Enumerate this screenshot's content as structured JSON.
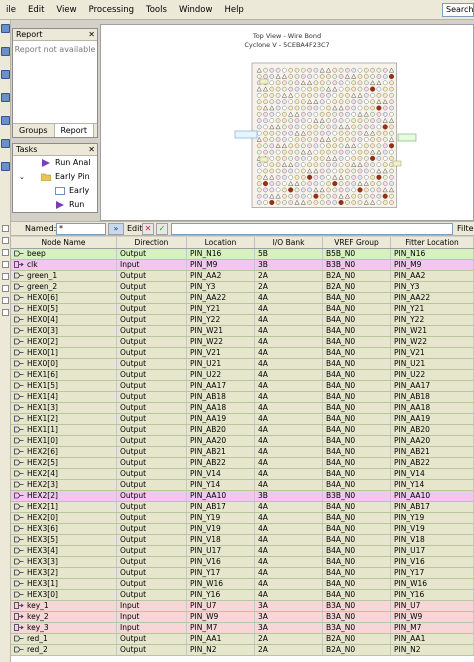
{
  "menu": {
    "items": [
      "ile",
      "Edit",
      "View",
      "Processing",
      "Tools",
      "Window",
      "Help"
    ],
    "search_text": "Search"
  },
  "report_panel": {
    "title": "Report",
    "message": "Report not available",
    "tabs": [
      "Groups",
      "Report"
    ]
  },
  "tasks_panel": {
    "title": "Tasks",
    "items": [
      {
        "label": "Run Anal",
        "icon": "play-icon"
      },
      {
        "label": "Early Pin",
        "icon": "folder-icon"
      },
      {
        "label": "Early",
        "icon": "document-icon"
      },
      {
        "label": "Run",
        "icon": "play-icon"
      }
    ]
  },
  "diagram": {
    "title_line1": "Top View - Wire Bond",
    "title_line2": "Cyclone V - 5CEBA4F23C7"
  },
  "filter_bar": {
    "named_label": "Named:",
    "named_value": "*",
    "edit_label": "Edit:",
    "filter_label": "Filter"
  },
  "table": {
    "columns": [
      "Node Name",
      "Direction",
      "Location",
      "I/O Bank",
      "VREF Group",
      "Fitter Location"
    ],
    "rows": [
      {
        "name": "beep",
        "dir": "Output",
        "loc": "PIN_N16",
        "bank": "5B",
        "vref": "B5B_N0",
        "fitter": "PIN_N16",
        "kind": "output",
        "bg": "#d6f0c0"
      },
      {
        "name": "clk",
        "dir": "Input",
        "loc": "PIN_M9",
        "bank": "3B",
        "vref": "B3B_N0",
        "fitter": "PIN_M9",
        "kind": "input",
        "bg": "#f2c6ee"
      },
      {
        "name": "green_1",
        "dir": "Output",
        "loc": "PIN_AA2",
        "bank": "2A",
        "vref": "B2A_N0",
        "fitter": "PIN_AA2",
        "kind": "output",
        "bg": "#e6e6cc"
      },
      {
        "name": "green_2",
        "dir": "Output",
        "loc": "PIN_Y3",
        "bank": "2A",
        "vref": "B2A_N0",
        "fitter": "PIN_Y3",
        "kind": "output",
        "bg": "#e6e6cc"
      },
      {
        "name": "HEX0[6]",
        "dir": "Output",
        "loc": "PIN_AA22",
        "bank": "4A",
        "vref": "B4A_N0",
        "fitter": "PIN_AA22",
        "kind": "output",
        "bg": "#e6e6cc"
      },
      {
        "name": "HEX0[5]",
        "dir": "Output",
        "loc": "PIN_Y21",
        "bank": "4A",
        "vref": "B4A_N0",
        "fitter": "PIN_Y21",
        "kind": "output",
        "bg": "#e6e6cc"
      },
      {
        "name": "HEX0[4]",
        "dir": "Output",
        "loc": "PIN_Y22",
        "bank": "4A",
        "vref": "B4A_N0",
        "fitter": "PIN_Y22",
        "kind": "output",
        "bg": "#e6e6cc"
      },
      {
        "name": "HEX0[3]",
        "dir": "Output",
        "loc": "PIN_W21",
        "bank": "4A",
        "vref": "B4A_N0",
        "fitter": "PIN_W21",
        "kind": "output",
        "bg": "#e6e6cc"
      },
      {
        "name": "HEX0[2]",
        "dir": "Output",
        "loc": "PIN_W22",
        "bank": "4A",
        "vref": "B4A_N0",
        "fitter": "PIN_W22",
        "kind": "output",
        "bg": "#e6e6cc"
      },
      {
        "name": "HEX0[1]",
        "dir": "Output",
        "loc": "PIN_V21",
        "bank": "4A",
        "vref": "B4A_N0",
        "fitter": "PIN_V21",
        "kind": "output",
        "bg": "#e6e6cc"
      },
      {
        "name": "HEX0[0]",
        "dir": "Output",
        "loc": "PIN_U21",
        "bank": "4A",
        "vref": "B4A_N0",
        "fitter": "PIN_U21",
        "kind": "output",
        "bg": "#e6e6cc"
      },
      {
        "name": "HEX1[6]",
        "dir": "Output",
        "loc": "PIN_U22",
        "bank": "4A",
        "vref": "B4A_N0",
        "fitter": "PIN_U22",
        "kind": "output",
        "bg": "#e6e6cc"
      },
      {
        "name": "HEX1[5]",
        "dir": "Output",
        "loc": "PIN_AA17",
        "bank": "4A",
        "vref": "B4A_N0",
        "fitter": "PIN_AA17",
        "kind": "output",
        "bg": "#e6e6cc"
      },
      {
        "name": "HEX1[4]",
        "dir": "Output",
        "loc": "PIN_AB18",
        "bank": "4A",
        "vref": "B4A_N0",
        "fitter": "PIN_AB18",
        "kind": "output",
        "bg": "#e6e6cc"
      },
      {
        "name": "HEX1[3]",
        "dir": "Output",
        "loc": "PIN_AA18",
        "bank": "4A",
        "vref": "B4A_N0",
        "fitter": "PIN_AA18",
        "kind": "output",
        "bg": "#e6e6cc"
      },
      {
        "name": "HEX1[2]",
        "dir": "Output",
        "loc": "PIN_AA19",
        "bank": "4A",
        "vref": "B4A_N0",
        "fitter": "PIN_AA19",
        "kind": "output",
        "bg": "#e6e6cc"
      },
      {
        "name": "HEX1[1]",
        "dir": "Output",
        "loc": "PIN_AB20",
        "bank": "4A",
        "vref": "B4A_N0",
        "fitter": "PIN_AB20",
        "kind": "output",
        "bg": "#e6e6cc"
      },
      {
        "name": "HEX1[0]",
        "dir": "Output",
        "loc": "PIN_AA20",
        "bank": "4A",
        "vref": "B4A_N0",
        "fitter": "PIN_AA20",
        "kind": "output",
        "bg": "#e6e6cc"
      },
      {
        "name": "HEX2[6]",
        "dir": "Output",
        "loc": "PIN_AB21",
        "bank": "4A",
        "vref": "B4A_N0",
        "fitter": "PIN_AB21",
        "kind": "output",
        "bg": "#e6e6cc"
      },
      {
        "name": "HEX2[5]",
        "dir": "Output",
        "loc": "PIN_AB22",
        "bank": "4A",
        "vref": "B4A_N0",
        "fitter": "PIN_AB22",
        "kind": "output",
        "bg": "#e6e6cc"
      },
      {
        "name": "HEX2[4]",
        "dir": "Output",
        "loc": "PIN_V14",
        "bank": "4A",
        "vref": "B4A_N0",
        "fitter": "PIN_V14",
        "kind": "output",
        "bg": "#e6e6cc"
      },
      {
        "name": "HEX2[3]",
        "dir": "Output",
        "loc": "PIN_Y14",
        "bank": "4A",
        "vref": "B4A_N0",
        "fitter": "PIN_Y14",
        "kind": "output",
        "bg": "#e6e6cc"
      },
      {
        "name": "HEX2[2]",
        "dir": "Output",
        "loc": "PIN_AA10",
        "bank": "3B",
        "vref": "B3B_N0",
        "fitter": "PIN_AA10",
        "kind": "output",
        "bg": "#f2c6ee"
      },
      {
        "name": "HEX2[1]",
        "dir": "Output",
        "loc": "PIN_AB17",
        "bank": "4A",
        "vref": "B4A_N0",
        "fitter": "PIN_AB17",
        "kind": "output",
        "bg": "#e6e6cc"
      },
      {
        "name": "HEX2[0]",
        "dir": "Output",
        "loc": "PIN_Y19",
        "bank": "4A",
        "vref": "B4A_N0",
        "fitter": "PIN_Y19",
        "kind": "output",
        "bg": "#e6e6cc"
      },
      {
        "name": "HEX3[6]",
        "dir": "Output",
        "loc": "PIN_V19",
        "bank": "4A",
        "vref": "B4A_N0",
        "fitter": "PIN_V19",
        "kind": "output",
        "bg": "#e6e6cc"
      },
      {
        "name": "HEX3[5]",
        "dir": "Output",
        "loc": "PIN_V18",
        "bank": "4A",
        "vref": "B4A_N0",
        "fitter": "PIN_V18",
        "kind": "output",
        "bg": "#e6e6cc"
      },
      {
        "name": "HEX3[4]",
        "dir": "Output",
        "loc": "PIN_U17",
        "bank": "4A",
        "vref": "B4A_N0",
        "fitter": "PIN_U17",
        "kind": "output",
        "bg": "#e6e6cc"
      },
      {
        "name": "HEX3[3]",
        "dir": "Output",
        "loc": "PIN_V16",
        "bank": "4A",
        "vref": "B4A_N0",
        "fitter": "PIN_V16",
        "kind": "output",
        "bg": "#e6e6cc"
      },
      {
        "name": "HEX3[2]",
        "dir": "Output",
        "loc": "PIN_Y17",
        "bank": "4A",
        "vref": "B4A_N0",
        "fitter": "PIN_Y17",
        "kind": "output",
        "bg": "#e6e6cc"
      },
      {
        "name": "HEX3[1]",
        "dir": "Output",
        "loc": "PIN_W16",
        "bank": "4A",
        "vref": "B4A_N0",
        "fitter": "PIN_W16",
        "kind": "output",
        "bg": "#e6e6cc"
      },
      {
        "name": "HEX3[0]",
        "dir": "Output",
        "loc": "PIN_Y16",
        "bank": "4A",
        "vref": "B4A_N0",
        "fitter": "PIN_Y16",
        "kind": "output",
        "bg": "#e6e6cc"
      },
      {
        "name": "key_1",
        "dir": "Input",
        "loc": "PIN_U7",
        "bank": "3A",
        "vref": "B3A_N0",
        "fitter": "PIN_U7",
        "kind": "input",
        "bg": "#f6d6d6"
      },
      {
        "name": "key_2",
        "dir": "Input",
        "loc": "PIN_W9",
        "bank": "3A",
        "vref": "B3A_N0",
        "fitter": "PIN_W9",
        "kind": "input",
        "bg": "#f6d6d6"
      },
      {
        "name": "key_3",
        "dir": "Input",
        "loc": "PIN_M7",
        "bank": "3A",
        "vref": "B3A_N0",
        "fitter": "PIN_M7",
        "kind": "input",
        "bg": "#f6d6d6"
      },
      {
        "name": "red_1",
        "dir": "Output",
        "loc": "PIN_AA1",
        "bank": "2A",
        "vref": "B2A_N0",
        "fitter": "PIN_AA1",
        "kind": "output",
        "bg": "#e6e6cc"
      },
      {
        "name": "red_2",
        "dir": "Output",
        "loc": "PIN_N2",
        "bank": "2A",
        "vref": "B2A_N0",
        "fitter": "PIN_N2",
        "kind": "output",
        "bg": "#e6e6cc"
      }
    ]
  }
}
